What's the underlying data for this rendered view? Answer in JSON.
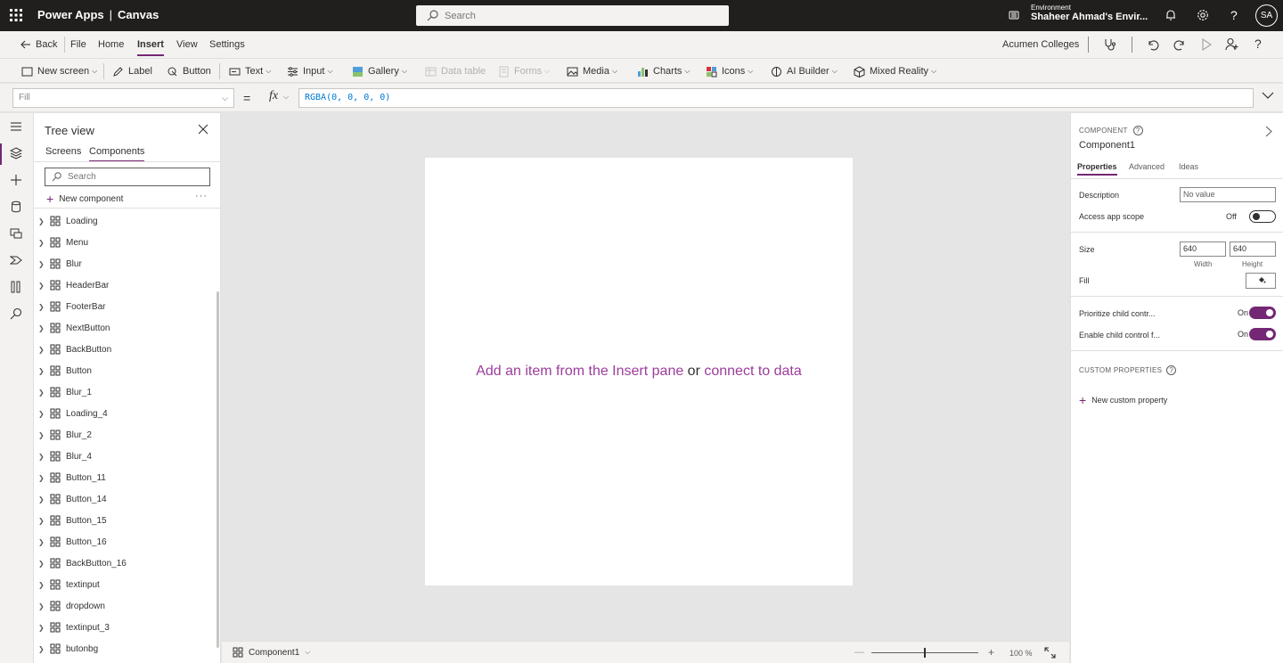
{
  "topbar": {
    "app_name": "Power Apps",
    "separator": "|",
    "app_type": "Canvas",
    "search_placeholder": "Search",
    "env_label": "Environment",
    "env_name": "Shaheer Ahmad's Envir...",
    "avatar": "SA"
  },
  "menubar": {
    "back": "Back",
    "file": "File",
    "home": "Home",
    "insert": "Insert",
    "view": "View",
    "settings": "Settings",
    "org": "Acumen Colleges"
  },
  "ribbon": {
    "new_screen": "New screen",
    "label": "Label",
    "button": "Button",
    "text": "Text",
    "input": "Input",
    "gallery": "Gallery",
    "data_table": "Data table",
    "forms": "Forms",
    "media": "Media",
    "charts": "Charts",
    "icons": "Icons",
    "ai_builder": "AI Builder",
    "mixed_reality": "Mixed Reality"
  },
  "formula": {
    "property": "Fill",
    "equals": "=",
    "fx": "fx",
    "value": "RGBA(0, 0, 0, 0)"
  },
  "treeview": {
    "title": "Tree view",
    "tab_screens": "Screens",
    "tab_components": "Components",
    "search_placeholder": "Search",
    "new_component": "New component",
    "more": "···",
    "items": [
      "Loading",
      "Menu",
      "Blur",
      "HeaderBar",
      "FooterBar",
      "NextButton",
      "BackButton",
      "Button",
      "Blur_1",
      "Loading_4",
      "Blur_2",
      "Blur_4",
      "Button_11",
      "Button_14",
      "Button_15",
      "Button_16",
      "BackButton_16",
      "textinput",
      "dropdown",
      "textinput_3",
      "butonbg"
    ]
  },
  "canvas": {
    "msg_part1": "Add an item from the Insert pane",
    "msg_or": " or ",
    "msg_part2": "connect to data"
  },
  "statusbar": {
    "component": "Component1",
    "zoom_minus": "—",
    "zoom_plus": "+",
    "zoom": "100 %"
  },
  "rightpanel": {
    "label": "COMPONENT",
    "help": "?",
    "name": "Component1",
    "tab_properties": "Properties",
    "tab_advanced": "Advanced",
    "tab_ideas": "Ideas",
    "description_label": "Description",
    "description_placeholder": "No value",
    "access_scope_label": "Access app scope",
    "access_scope_state": "Off",
    "size_label": "Size",
    "width_value": "640",
    "height_value": "640",
    "width_label": "Width",
    "height_label": "Height",
    "fill_label": "Fill",
    "prioritize_label": "Prioritize child contr...",
    "prioritize_state": "On",
    "enable_label": "Enable child control f...",
    "enable_state": "On",
    "custom_props": "CUSTOM PROPERTIES",
    "new_custom_prop": "New custom property"
  },
  "colors": {
    "accent": "#742774",
    "topbar_bg": "#201f1e",
    "link_purple": "#9b3d9b"
  }
}
